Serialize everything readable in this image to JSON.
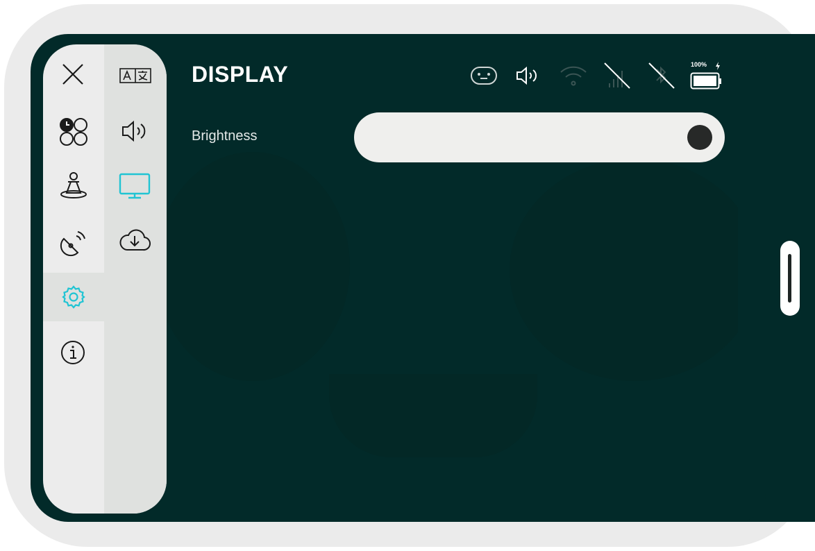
{
  "header": {
    "title": "DISPLAY"
  },
  "settings": {
    "brightness_label": "Brightness",
    "brightness_level": 1.0
  },
  "status_bar": {
    "battery_percent": "100%"
  },
  "sidebar": {
    "primary": [
      "close-icon",
      "dashboard-icon",
      "pilot-icon",
      "satellite-icon",
      "settings-icon",
      "info-icon"
    ],
    "secondary": [
      "language-icon",
      "volume-icon",
      "display-icon",
      "cloud-download-icon"
    ],
    "selected_primary": "settings-icon",
    "selected_secondary": "display-icon"
  },
  "colors": {
    "accent": "#20c4d3",
    "background": "#022a29",
    "sidebar": "#ececec",
    "sidebar_secondary": "#dfe1df"
  }
}
